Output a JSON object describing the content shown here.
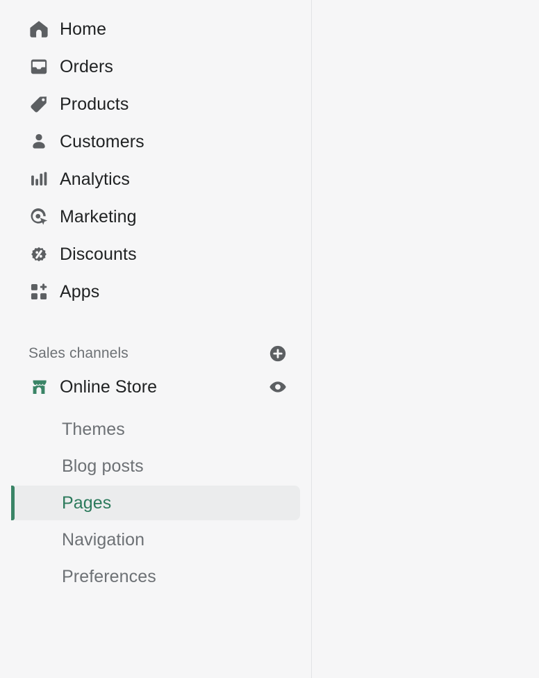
{
  "sidebar": {
    "primary_nav": [
      {
        "label": "Home",
        "icon": "home-icon",
        "active": false
      },
      {
        "label": "Orders",
        "icon": "orders-icon",
        "active": false
      },
      {
        "label": "Products",
        "icon": "products-icon",
        "active": false
      },
      {
        "label": "Customers",
        "icon": "customers-icon",
        "active": false
      },
      {
        "label": "Analytics",
        "icon": "analytics-icon",
        "active": false
      },
      {
        "label": "Marketing",
        "icon": "marketing-icon",
        "active": false
      },
      {
        "label": "Discounts",
        "icon": "discounts-icon",
        "active": false
      },
      {
        "label": "Apps",
        "icon": "apps-icon",
        "active": false
      }
    ],
    "sales_channels": {
      "title": "Sales channels",
      "add_icon": "plus-circle-icon",
      "channel": {
        "label": "Online Store",
        "icon": "storefront-icon",
        "view_icon": "eye-icon"
      },
      "sub_items": [
        {
          "label": "Themes",
          "active": false
        },
        {
          "label": "Blog posts",
          "active": false
        },
        {
          "label": "Pages",
          "active": true
        },
        {
          "label": "Navigation",
          "active": false
        },
        {
          "label": "Preferences",
          "active": false
        }
      ]
    }
  },
  "colors": {
    "background": "#f6f6f7",
    "border": "#e1e3e5",
    "text_primary": "#202223",
    "text_subdued": "#6d7175",
    "accent_green": "#2c7a5c",
    "marker_green": "#3a8466",
    "active_pill": "#ebeced",
    "icon_gray": "#5c5f62",
    "store_green": "#3a8466"
  }
}
